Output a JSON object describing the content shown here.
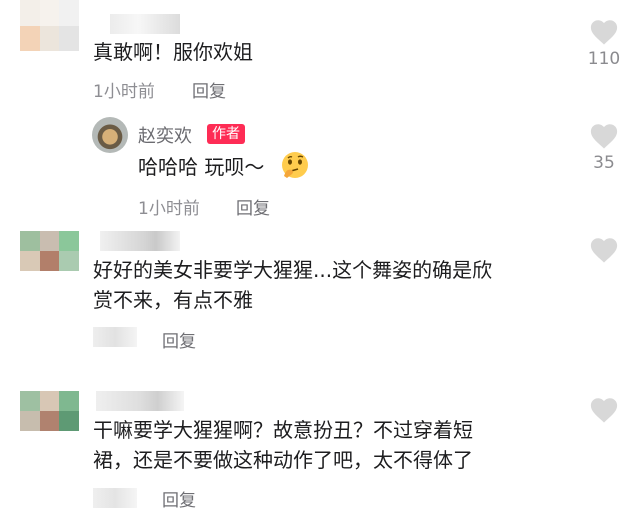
{
  "comments": [
    {
      "text": "真敢啊！服你欢姐",
      "time": "1小时前",
      "reply": "回复",
      "likes": "110"
    },
    {
      "author": "赵奕欢",
      "badge": "作者",
      "text": "哈哈哈 玩呗～",
      "time": "1小时前",
      "reply": "回复",
      "likes": "35"
    },
    {
      "text_line1": "好好的美女非要学大猩猩...这个舞姿的确是欣",
      "text_line2": "赏不来，有点不雅",
      "reply": "回复"
    },
    {
      "text_line1": "干嘛要学大猩猩啊？故意扮丑？不过穿着短",
      "text_line2": "裙，还是不要做这种动作了吧，太不得体了",
      "reply": "回复"
    }
  ],
  "colors": {
    "accent": "#fe2c55",
    "meta": "#8e8e93",
    "heart": "#d8d8d8"
  },
  "icons": {
    "like": "heart-icon",
    "emoji": "thinking-emoji-icon"
  }
}
